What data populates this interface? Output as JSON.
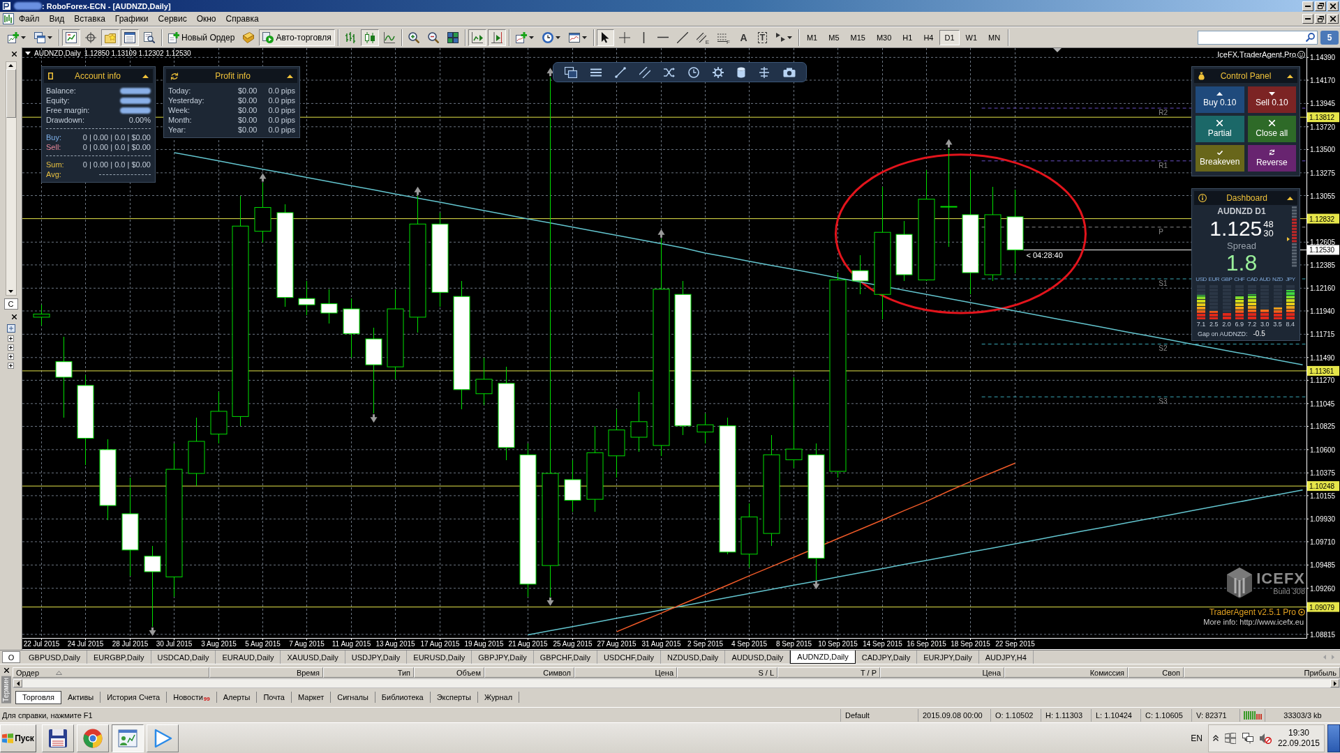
{
  "window": {
    "title": ": RoboForex-ECN - [AUDNZD,Daily]",
    "account_hidden": true
  },
  "menu": [
    "Файл",
    "Вид",
    "Вставка",
    "Графики",
    "Сервис",
    "Окно",
    "Справка"
  ],
  "toolbar": {
    "groups": [
      [
        {
          "kind": "icon",
          "dropdown": true,
          "pressed": false
        },
        {
          "kind": "icon",
          "dropdown": true,
          "pressed": false
        }
      ],
      [
        {
          "kind": "icon",
          "pressed": true
        },
        {
          "kind": "icon",
          "pressed": false
        },
        {
          "kind": "icon",
          "pressed": true
        },
        {
          "kind": "icon",
          "pressed": true
        },
        {
          "kind": "icon",
          "pressed": false
        }
      ],
      [
        {
          "kind": "text",
          "label": "Новый Ордер",
          "pressed": false
        },
        {
          "kind": "icon",
          "pressed": false
        },
        {
          "kind": "text",
          "label": "Авто-торговля",
          "pressed": true
        }
      ],
      [
        {
          "kind": "icon",
          "pressed": false
        },
        {
          "kind": "icon",
          "pressed": true
        },
        {
          "kind": "icon",
          "pressed": false
        }
      ],
      [
        {
          "kind": "icon",
          "pressed": false
        },
        {
          "kind": "icon",
          "pressed": false
        },
        {
          "kind": "icon",
          "pressed": false
        }
      ],
      [
        {
          "kind": "icon",
          "pressed": true
        },
        {
          "kind": "icon",
          "pressed": true
        }
      ],
      [
        {
          "kind": "icon",
          "dropdown": true,
          "pressed": false
        },
        {
          "kind": "icon",
          "dropdown": true,
          "pressed": false
        },
        {
          "kind": "icon",
          "dropdown": true,
          "pressed": false
        }
      ],
      [
        {
          "kind": "icon",
          "pressed": true
        },
        {
          "kind": "icon",
          "pressed": false
        },
        {
          "kind": "icon",
          "pressed": false
        },
        {
          "kind": "icon",
          "pressed": false
        },
        {
          "kind": "icon",
          "pressed": false
        },
        {
          "kind": "icon",
          "glyph": "E",
          "pressed": false
        },
        {
          "kind": "icon",
          "glyph": "F",
          "pressed": false
        },
        {
          "kind": "glyph",
          "glyph": "A",
          "pressed": false
        },
        {
          "kind": "glyph",
          "glyph": "T",
          "framed": true,
          "pressed": false
        },
        {
          "kind": "icon",
          "dropdown": true,
          "pressed": false
        }
      ]
    ],
    "timeframes": [
      {
        "label": "M1",
        "selected": false
      },
      {
        "label": "M5",
        "selected": false
      },
      {
        "label": "M15",
        "selected": false
      },
      {
        "label": "M30",
        "selected": false
      },
      {
        "label": "H1",
        "selected": false
      },
      {
        "label": "H4",
        "selected": false
      },
      {
        "label": "D1",
        "selected": true
      },
      {
        "label": "W1",
        "selected": false
      },
      {
        "label": "MN",
        "selected": false
      }
    ],
    "notifications": "5"
  },
  "left_panel": {
    "upper_tab": "С",
    "tree": [
      {
        "expanded": false
      },
      {
        "expanded": false
      },
      {
        "expanded": false
      },
      {
        "expanded": false
      }
    ],
    "lower_tab": "О"
  },
  "chart": {
    "symbol": "AUDNZD,Daily",
    "quote": "1.12850 1.13109 1.12302 1.12530",
    "expert": "IceFX.TraderAgent.Pro",
    "account_info": {
      "title": "Account info",
      "rows": [
        {
          "label": "Balance:",
          "hidden": true
        },
        {
          "label": "Equity:",
          "hidden": true
        },
        {
          "label": "Free margin:",
          "hidden": true
        },
        {
          "label": "Drawdown:",
          "value": "0.00%",
          "hidden": false
        }
      ],
      "positions": [
        {
          "kind": "buy",
          "label": "Buy:",
          "value": "0 | 0.00 | 0.0 | $0.00"
        },
        {
          "kind": "sell",
          "label": "Sell:",
          "value": "0 | 0.00 | 0.0 | $0.00"
        }
      ],
      "totals": [
        {
          "kind": "sum",
          "label": "Sum:",
          "value": "0 | 0.00 | 0.0 | $0.00"
        },
        {
          "kind": "avg",
          "label": "Avg:"
        }
      ]
    },
    "profit_info": {
      "title": "Profit info",
      "rows": [
        {
          "label": "Today:",
          "amount": "$0.00",
          "pips": "0.0 pips"
        },
        {
          "label": "Yesterday:",
          "amount": "$0.00",
          "pips": "0.0 pips"
        },
        {
          "label": "Week:",
          "amount": "$0.00",
          "pips": "0.0 pips"
        },
        {
          "label": "Month:",
          "amount": "$0.00",
          "pips": "0.0 pips"
        },
        {
          "label": "Year:",
          "amount": "$0.00",
          "pips": "0.0 pips"
        }
      ]
    },
    "control_panel": {
      "title": "Control Panel",
      "buttons": [
        {
          "kind": "buy",
          "label": "Buy 0.10",
          "color": "#1f4a7c"
        },
        {
          "kind": "sell",
          "label": "Sell 0.10",
          "color": "#7c2424"
        },
        {
          "kind": "partial",
          "label": "Partial",
          "color": "#1b6868"
        },
        {
          "kind": "close",
          "label": "Close all",
          "color": "#2e6a28"
        },
        {
          "kind": "breakeven",
          "label": "Breakeven",
          "color": "#68661a"
        },
        {
          "kind": "reverse",
          "label": "Reverse",
          "color": "#682470"
        }
      ]
    },
    "dashboard": {
      "title": "Dashboard",
      "symbol": "AUDNZD D1",
      "price": "1.125",
      "ask_digits": "48",
      "bid_digits": "30",
      "spread_label": "Spread",
      "spread": "1.8",
      "strength": [
        {
          "currency": "USD",
          "value": "7.1",
          "level": 0.71
        },
        {
          "currency": "EUR",
          "value": "2.5",
          "level": 0.25
        },
        {
          "currency": "GBP",
          "value": "2.0",
          "level": 0.2
        },
        {
          "currency": "CHF",
          "value": "6.9",
          "level": 0.69
        },
        {
          "currency": "CAD",
          "value": "7.2",
          "level": 0.72
        },
        {
          "currency": "AUD",
          "value": "3.0",
          "level": 0.3
        },
        {
          "currency": "NZD",
          "value": "3.5",
          "level": 0.35
        },
        {
          "currency": "JPY",
          "value": "8.4",
          "level": 0.84
        }
      ],
      "gap_label": "Gap on AUDNZD:",
      "gap": "-0.5"
    },
    "branding": {
      "logo": "ICEFX",
      "build": "Build 308",
      "version": "TraderAgent v2.5.1 Pro",
      "info": "More info: http://www.icefx.eu"
    },
    "chart_data": [
      {
        "type": "candlestick",
        "categories": [
          "22 Jul 2015",
          null,
          "24 Jul 2015",
          null,
          "28 Jul 2015",
          null,
          "30 Jul 2015",
          null,
          "3 Aug 2015",
          null,
          "5 Aug 2015",
          null,
          "7 Aug 2015",
          null,
          "11 Aug 2015",
          null,
          "13 Aug 2015",
          null,
          "17 Aug 2015",
          null,
          "19 Aug 2015",
          null,
          "21 Aug 2015",
          null,
          "25 Aug 2015",
          null,
          "27 Aug 2015",
          null,
          "31 Aug 2015",
          null,
          "2 Sep 2015",
          null,
          "4 Sep 2015",
          null,
          "8 Sep 2015",
          null,
          "10 Sep 2015",
          null,
          "14 Sep 2015",
          null,
          "16 Sep 2015",
          null,
          "18 Sep 2015",
          null,
          "22 Sep 2015",
          null,
          null,
          null,
          null,
          null,
          null,
          null,
          null,
          null,
          null,
          null,
          null,
          null
        ],
        "ohlc": [
          [
            1.1188,
            1.12,
            1.118,
            1.1191
          ],
          [
            1.1145,
            1.1169,
            1.1091,
            1.113
          ],
          [
            1.1122,
            1.1132,
            1.1045,
            1.1071
          ],
          [
            1.106,
            1.107,
            1.0992,
            1.1006
          ],
          [
            1.0998,
            1.1033,
            1.0938,
            1.0963
          ],
          [
            1.0957,
            1.0967,
            1.0889,
            1.0942
          ],
          [
            1.0937,
            1.1066,
            1.0918,
            1.1041
          ],
          [
            1.1037,
            1.1091,
            1.1025,
            1.1068
          ],
          [
            1.1075,
            1.1116,
            1.1066,
            1.1097
          ],
          [
            1.1092,
            1.1305,
            1.1083,
            1.1276
          ],
          [
            1.1271,
            1.1318,
            1.126,
            1.1294
          ],
          [
            1.1289,
            1.1297,
            1.1198,
            1.1207
          ],
          [
            1.1206,
            1.1223,
            1.119,
            1.12
          ],
          [
            1.1201,
            1.1215,
            1.1182,
            1.1192
          ],
          [
            1.1196,
            1.1206,
            1.1149,
            1.1172
          ],
          [
            1.1167,
            1.1178,
            1.1095,
            1.1142
          ],
          [
            1.114,
            1.1215,
            1.1128,
            1.1196
          ],
          [
            1.1188,
            1.1305,
            1.1173,
            1.1278
          ],
          [
            1.1278,
            1.1289,
            1.1198,
            1.1212
          ],
          [
            1.1208,
            1.1223,
            1.1099,
            1.1118
          ],
          [
            1.1114,
            1.1149,
            1.1103,
            1.1128
          ],
          [
            1.1124,
            1.114,
            1.105,
            1.1062
          ],
          [
            1.1055,
            1.1066,
            1.0918,
            1.093
          ],
          [
            1.0948,
            1.142,
            1.0918,
            1.1037
          ],
          [
            1.1031,
            1.105,
            1.1,
            1.1011
          ],
          [
            1.1012,
            1.1083,
            1.1,
            1.1057
          ],
          [
            1.1054,
            1.1099,
            1.1033,
            1.1079
          ],
          [
            1.1072,
            1.1116,
            1.1058,
            1.1087
          ],
          [
            1.1064,
            1.1264,
            1.1054,
            1.1215
          ],
          [
            1.121,
            1.1223,
            1.1074,
            1.1083
          ],
          [
            1.1077,
            1.1095,
            1.1066,
            1.1084
          ],
          [
            1.1083,
            1.1091,
            1.0959,
            1.0961
          ],
          [
            1.0959,
            1.1008,
            1.0946,
            1.0995
          ],
          [
            1.0979,
            1.1074,
            1.0967,
            1.1055
          ],
          [
            1.10502,
            1.11303,
            1.10424,
            1.10605
          ],
          [
            1.1055,
            1.1066,
            1.0934,
            1.0955
          ],
          [
            1.1039,
            1.1231,
            1.1033,
            1.1224
          ],
          [
            1.1233,
            1.1248,
            1.121,
            1.1223
          ],
          [
            1.121,
            1.1314,
            1.1186,
            1.127
          ],
          [
            1.1268,
            1.1281,
            1.1223,
            1.1229
          ],
          [
            1.1224,
            1.133,
            1.1223,
            1.1302
          ],
          [
            1.1295,
            1.1351,
            1.1256,
            1.1295
          ],
          [
            1.1287,
            1.133,
            1.121,
            1.1231
          ],
          [
            1.1229,
            1.1314,
            1.1223,
            1.1287
          ],
          [
            1.1285,
            1.13109,
            1.12302,
            1.1253
          ],
          null,
          null,
          null,
          null,
          null,
          null,
          null,
          null,
          null,
          null,
          null,
          null,
          null
        ],
        "series": [
          {
            "type": "line",
            "color": "#63c5cf",
            "values": [
              null,
              null,
              null,
              null,
              null,
              null,
              1.1347,
              1.1343,
              1.1339,
              1.1335,
              1.1331,
              1.1327,
              1.1323,
              1.1319,
              1.1315,
              1.1311,
              1.1307,
              1.1303,
              1.1299,
              1.1295,
              1.1291,
              1.1287,
              1.1283,
              1.1279,
              1.1275,
              1.1271,
              1.1267,
              1.1263,
              1.1259,
              1.1255,
              1.125,
              1.1246,
              1.1242,
              1.1238,
              1.1234,
              1.123,
              1.1226,
              1.1222,
              null,
              1.1214,
              1.121,
              1.1206,
              1.1202,
              1.1198,
              1.1194,
              1.119,
              1.1186,
              1.1182,
              1.1178,
              1.1174,
              1.117,
              1.1166,
              1.1162,
              1.1158,
              1.1154,
              1.115,
              1.1146,
              1.1142
            ]
          },
          {
            "type": "line",
            "color": "#63c5cf",
            "values": [
              null,
              null,
              null,
              null,
              null,
              null,
              null,
              null,
              null,
              null,
              null,
              null,
              null,
              null,
              null,
              null,
              null,
              null,
              null,
              null,
              null,
              null,
              1.0881,
              1.0885,
              1.0889,
              1.0893,
              1.0897,
              1.0901,
              1.0905,
              1.0909,
              1.0913,
              1.0917,
              1.0921,
              1.0925,
              1.0929,
              1.0933,
              1.0937,
              1.0941,
              1.0945,
              1.0949,
              1.0953,
              1.0957,
              1.0961,
              1.0965,
              1.0969,
              1.0973,
              1.0977,
              1.0981,
              1.0985,
              1.0989,
              1.0993,
              1.0997,
              1.1001,
              1.1005,
              1.1009,
              1.1013,
              1.1017,
              1.1021
            ]
          },
          {
            "type": "line",
            "color": "#f05a28",
            "values": [
              null,
              null,
              null,
              null,
              null,
              null,
              null,
              null,
              null,
              null,
              null,
              null,
              null,
              null,
              null,
              null,
              null,
              null,
              null,
              null,
              null,
              null,
              null,
              null,
              null,
              null,
              1.0884,
              1.0893,
              1.0902,
              1.0911,
              1.092,
              1.0929,
              1.0938,
              1.0947,
              1.0956,
              null,
              1.0974,
              1.0983,
              1.0992,
              1.1001,
              1.101,
              1.102,
              1.1029,
              1.1038,
              1.1047,
              null,
              null,
              null,
              null,
              null,
              null,
              null,
              null,
              null,
              null,
              null,
              null,
              null
            ]
          },
          {
            "type": "scatter",
            "color": "#9a9a9a",
            "values": [
              null,
              null,
              null,
              null,
              null,
              null,
              null,
              null,
              null,
              null,
              1.1323,
              null,
              null,
              null,
              null,
              null,
              null,
              1.131,
              null,
              null,
              null,
              null,
              null,
              1.1425,
              null,
              null,
              null,
              null,
              1.1269,
              null,
              null,
              null,
              null,
              null,
              null,
              null,
              null,
              null,
              null,
              null,
              null,
              1.1356,
              null,
              null,
              null,
              null,
              null,
              null,
              null,
              null,
              null,
              null,
              null,
              null,
              null,
              null,
              null,
              null
            ]
          },
          {
            "type": "scatter",
            "color": "#9a9a9a",
            "values": [
              null,
              null,
              null,
              null,
              null,
              1.0884,
              null,
              null,
              null,
              null,
              null,
              null,
              null,
              null,
              null,
              1.109,
              null,
              null,
              null,
              null,
              null,
              null,
              null,
              1.0913,
              null,
              null,
              null,
              null,
              null,
              null,
              null,
              null,
              null,
              null,
              null,
              1.0929,
              null,
              null,
              null,
              null,
              null,
              null,
              null,
              null,
              null,
              null,
              null,
              null,
              null,
              null,
              null,
              null,
              null,
              null,
              null,
              null,
              null,
              null
            ]
          }
        ],
        "ylim": [
          1.0878,
          1.1448
        ],
        "yticks": [
          {
            "value": 1.1439,
            "label": "1.14390"
          },
          {
            "value": 1.1417,
            "label": "1.14170"
          },
          {
            "value": 1.13945,
            "label": "1.13945"
          },
          {
            "value": 1.1372,
            "label": "1.13720"
          },
          {
            "value": 1.135,
            "label": "1.13500"
          },
          {
            "value": 1.13275,
            "label": "1.13275"
          },
          {
            "value": 1.13055,
            "label": "1.13055"
          },
          {
            "value": 1.12605,
            "label": "1.12605"
          },
          {
            "value": 1.12385,
            "label": "1.12385"
          },
          {
            "value": 1.1216,
            "label": "1.12160"
          },
          {
            "value": 1.1194,
            "label": "1.11940"
          },
          {
            "value": 1.11715,
            "label": "1.11715"
          },
          {
            "value": 1.1149,
            "label": "1.11490"
          },
          {
            "value": 1.1127,
            "label": "1.11270"
          },
          {
            "value": 1.11045,
            "label": "1.11045"
          },
          {
            "value": 1.10825,
            "label": "1.10825"
          },
          {
            "value": 1.106,
            "label": "1.10600"
          },
          {
            "value": 1.10375,
            "label": "1.10375"
          },
          {
            "value": 1.10155,
            "label": "1.10155"
          },
          {
            "value": 1.0993,
            "label": "1.09930"
          },
          {
            "value": 1.0971,
            "label": "1.09710"
          },
          {
            "value": 1.09485,
            "label": "1.09485"
          },
          {
            "value": 1.0926,
            "label": "1.09260"
          },
          {
            "value": 1.08815,
            "label": "1.08815"
          }
        ],
        "grid": true,
        "ref_lines": [
          {
            "axis": "y",
            "value": 1.13812,
            "label": "1.13812",
            "color": "#e6e64a",
            "line_style": "solid"
          },
          {
            "axis": "y",
            "value": 1.12832,
            "label": "1.12832",
            "color": "#e6e64a",
            "line_style": "solid"
          },
          {
            "axis": "y",
            "value": 1.1253,
            "label": "1.12530",
            "color": "#ffffff",
            "line_style": "solid"
          },
          {
            "axis": "y",
            "value": 1.11361,
            "label": "1.11361",
            "color": "#e6e64a",
            "line_style": "solid"
          },
          {
            "axis": "y",
            "value": 1.10248,
            "label": "1.10248",
            "color": "#e6e64a",
            "line_style": "solid"
          },
          {
            "axis": "y",
            "value": 1.09079,
            "label": "1.09079",
            "color": "#e6e64a",
            "line_style": "solid"
          },
          {
            "axis": "y",
            "value": 1.139,
            "label": "R2",
            "color": "#6a50c8",
            "line_style": "dashed"
          },
          {
            "axis": "y",
            "value": 1.1339,
            "label": "R1",
            "color": "#6a50c8",
            "line_style": "dashed"
          },
          {
            "axis": "y",
            "value": 1.1275,
            "label": "P",
            "color": "#8a8a8a",
            "line_style": "dashed"
          },
          {
            "axis": "y",
            "value": 1.1225,
            "label": "S1",
            "color": "#3aa8b8",
            "line_style": "dashed"
          },
          {
            "axis": "y",
            "value": 1.1162,
            "label": "S2",
            "color": "#3aa8b8",
            "line_style": "dashed"
          },
          {
            "axis": "y",
            "value": 1.1111,
            "label": "S3",
            "color": "#3aa8b8",
            "line_style": "dashed"
          }
        ],
        "annotations": [
          "< 04:28:40"
        ]
      }
    ]
  },
  "symbol_tabs": [
    {
      "label": "GBPUSD,Daily",
      "selected": false
    },
    {
      "label": "EURGBP,Daily",
      "selected": false
    },
    {
      "label": "USDCAD,Daily",
      "selected": false
    },
    {
      "label": "EURAUD,Daily",
      "selected": false
    },
    {
      "label": "XAUUSD,Daily",
      "selected": false
    },
    {
      "label": "USDJPY,Daily",
      "selected": false
    },
    {
      "label": "EURUSD,Daily",
      "selected": false
    },
    {
      "label": "GBPJPY,Daily",
      "selected": false
    },
    {
      "label": "GBPCHF,Daily",
      "selected": false
    },
    {
      "label": "USDCHF,Daily",
      "selected": false
    },
    {
      "label": "NZDUSD,Daily",
      "selected": false
    },
    {
      "label": "AUDUSD,Daily",
      "selected": false
    },
    {
      "label": "AUDNZD,Daily",
      "selected": true
    },
    {
      "label": "CADJPY,Daily",
      "selected": false
    },
    {
      "label": "EURJPY,Daily",
      "selected": false
    },
    {
      "label": "AUDJPY,H4",
      "selected": false
    }
  ],
  "terminal": {
    "title": "Термин",
    "columns": [
      {
        "label": "Ордер",
        "sorted": true
      },
      {
        "label": "Время",
        "sorted": false
      },
      {
        "label": "Тип",
        "sorted": false
      },
      {
        "label": "Объем",
        "sorted": false
      },
      {
        "label": "Символ",
        "sorted": false
      },
      {
        "label": "Цена",
        "sorted": false
      },
      {
        "label": "S / L",
        "sorted": false
      },
      {
        "label": "T / P",
        "sorted": false
      },
      {
        "label": "Цена",
        "sorted": false
      },
      {
        "label": "Комиссия",
        "sorted": false
      },
      {
        "label": "Своп",
        "sorted": false
      },
      {
        "label": "Прибыль",
        "sorted": false
      }
    ],
    "tabs": [
      {
        "label": "Торговля",
        "selected": true
      },
      {
        "label": "Активы",
        "selected": false
      },
      {
        "label": "История Счета",
        "selected": false
      },
      {
        "label": "Новости",
        "badge": "99",
        "selected": false
      },
      {
        "label": "Алерты",
        "selected": false
      },
      {
        "label": "Почта",
        "selected": false
      },
      {
        "label": "Маркет",
        "selected": false
      },
      {
        "label": "Сигналы",
        "selected": false
      },
      {
        "label": "Библиотека",
        "selected": false
      },
      {
        "label": "Эксперты",
        "selected": false
      },
      {
        "label": "Журнал",
        "selected": false
      }
    ]
  },
  "status_bar": {
    "help": "Для справки, нажмите F1",
    "profile": "Default",
    "bar_time": "2015.09.08 00:00",
    "open": "O: 1.10502",
    "high": "H: 1.11303",
    "low": "L: 1.10424",
    "close": "C: 1.10605",
    "volume": "V: 82371",
    "traffic": "33303/3 kb"
  },
  "taskbar": {
    "start": "Пуск",
    "apps": [
      {
        "selected": false
      },
      {
        "selected": false
      },
      {
        "selected": true
      },
      {
        "selected": false
      }
    ],
    "language": "EN",
    "time": "19:30",
    "date": "22.09.2015"
  }
}
